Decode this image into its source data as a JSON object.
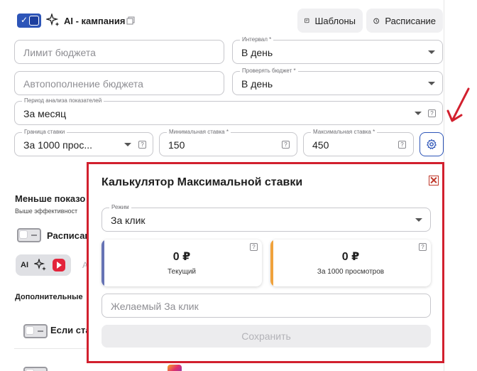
{
  "header": {
    "campaign_title": "AI - кампания",
    "templates_label": "Шаблоны",
    "schedule_label": "Расписание"
  },
  "form": {
    "budget_limit_placeholder": "Лимит бюджета",
    "interval_label": "Интервал *",
    "interval_value": "В день",
    "autofill_placeholder": "Автопополнение бюджета",
    "check_budget_label": "Проверять бюджет *",
    "check_budget_value": "В день",
    "analysis_period_label": "Период анализа показателей",
    "analysis_period_value": "За месяц",
    "bid_bound_label": "Граница ставки",
    "bid_bound_value": "За 1000 прос...",
    "min_bid_label": "Минимальная ставка *",
    "min_bid_value": "150",
    "max_bid_label": "Максимальная ставка *",
    "max_bid_value": "450"
  },
  "background": {
    "less_shows_title": "Меньше показо",
    "higher_eff_text": "Выше эффективност",
    "schedule_toggle_label": "Расписани",
    "ai_pill_label": "AI",
    "ai_pill_trailing": "A",
    "additional_label": "Дополнительные",
    "if_toggle_label": "Если ста"
  },
  "modal": {
    "title": "Калькулятор Максимальной ставки",
    "mode_label": "Режим",
    "mode_value": "За клик",
    "current_value": "0 ₽",
    "current_label": "Текущий",
    "per1000_value": "0 ₽",
    "per1000_label": "За 1000 просмотров",
    "desired_placeholder": "Желаемый За клик",
    "save_label": "Сохранить"
  },
  "colors": {
    "accent_blue": "#2d55b8",
    "highlight_red": "#d2202e",
    "card_bar_blue": "#6673b5",
    "card_bar_orange": "#f0a23c"
  },
  "icons": {
    "sparkle": "sparkle-icon",
    "copy": "copy-icon",
    "templates": "template-icon",
    "schedule": "clock-icon",
    "gear": "gear-icon",
    "help": "help-icon",
    "close": "close-icon",
    "arrow": "red-arrow-annotation"
  }
}
